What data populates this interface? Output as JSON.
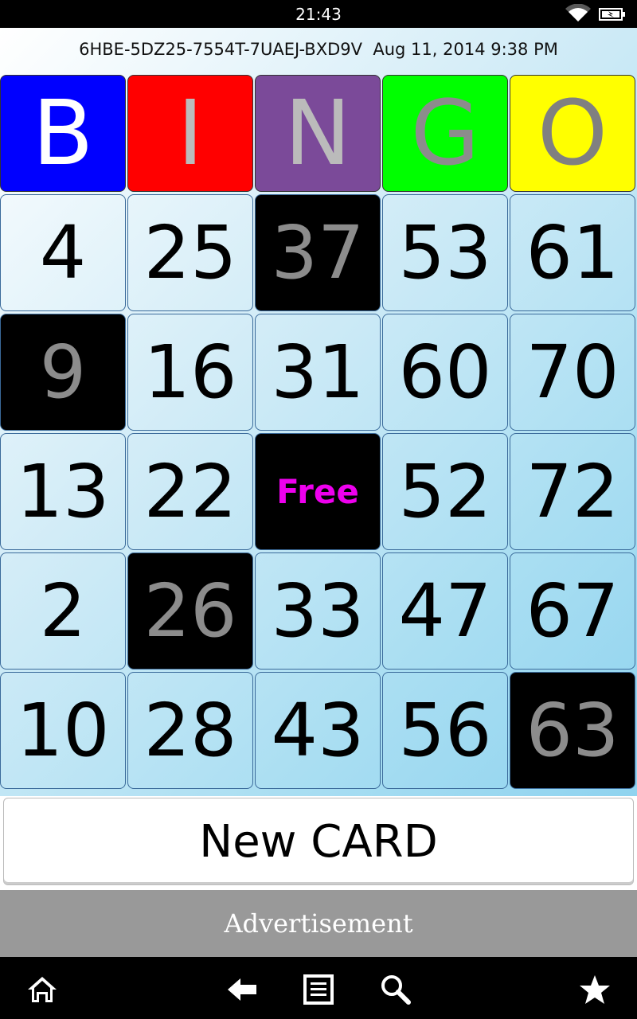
{
  "status_bar": {
    "time": "21:43"
  },
  "card": {
    "id": "6HBE-5DZ25-7554T-7UAEJ-BXD9V",
    "date": "Aug 11, 2014 9:38 PM"
  },
  "header": [
    {
      "letter": "B",
      "bg": "#0000ff",
      "fg": "#ffffff"
    },
    {
      "letter": "I",
      "bg": "#ff0000",
      "fg": "#bbbbbb"
    },
    {
      "letter": "N",
      "bg": "#7b4a99",
      "fg": "#bbbbbb"
    },
    {
      "letter": "G",
      "bg": "#00ff00",
      "fg": "#8c8c8c"
    },
    {
      "letter": "O",
      "bg": "#ffff00",
      "fg": "#808080"
    }
  ],
  "rows": [
    [
      "4",
      "25",
      "37",
      "53",
      "61"
    ],
    [
      "9",
      "16",
      "31",
      "60",
      "70"
    ],
    [
      "13",
      "22",
      "Free",
      "52",
      "72"
    ],
    [
      "2",
      "26",
      "33",
      "47",
      "67"
    ],
    [
      "10",
      "28",
      "43",
      "56",
      "63"
    ]
  ],
  "marked": [
    [
      false,
      false,
      true,
      false,
      false
    ],
    [
      true,
      false,
      false,
      false,
      false
    ],
    [
      false,
      false,
      true,
      false,
      false
    ],
    [
      false,
      true,
      false,
      false,
      false
    ],
    [
      false,
      false,
      false,
      false,
      true
    ]
  ],
  "new_card_label": "New CARD",
  "ad_label": "Advertisement",
  "nav_icons": [
    "home-icon",
    "back-icon",
    "list-icon",
    "search-icon",
    "star-icon"
  ]
}
